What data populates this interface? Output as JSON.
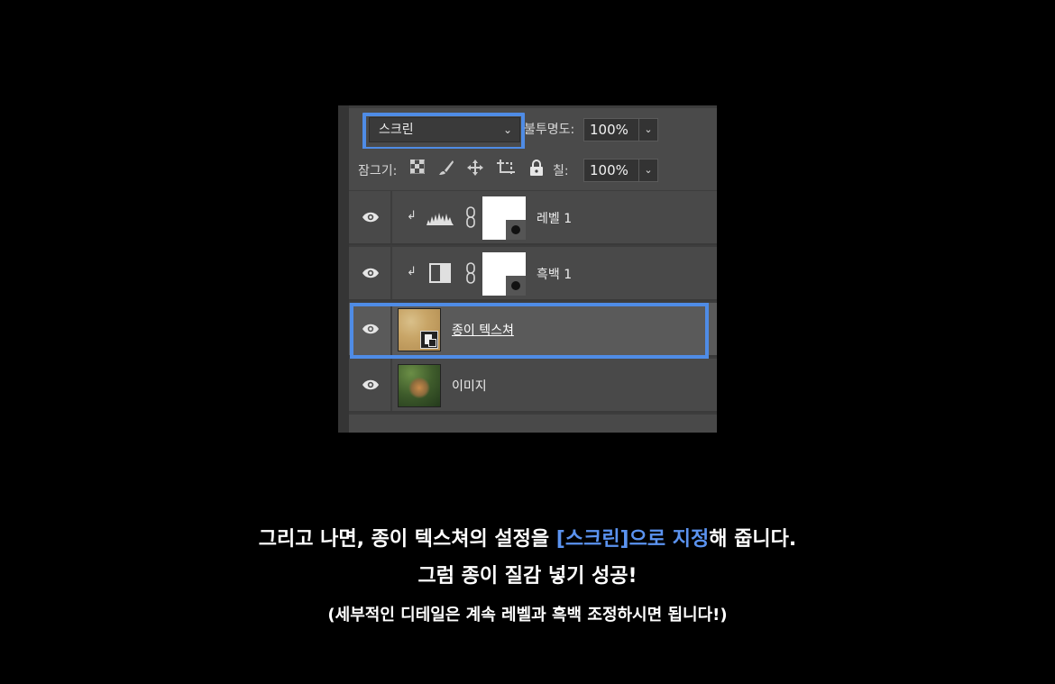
{
  "panel": {
    "blend_mode": "스크린",
    "opacity_label": "불투명도:",
    "opacity_value": "100%",
    "lock_label": "잠그기:",
    "fill_label": "칠:",
    "fill_value": "100%",
    "layers": [
      {
        "name": "레벨 1",
        "type": "levels-adjustment",
        "clipped": true
      },
      {
        "name": "흑백 1",
        "type": "black-white-adjustment",
        "clipped": true
      },
      {
        "name": "종이 텍스쳐",
        "type": "smart-object",
        "selected": true
      },
      {
        "name": "이미지",
        "type": "image"
      }
    ]
  },
  "caption": {
    "line1_a": "그리고 나면, 종이 텍스쳐의 설정을 ",
    "line1_b": "[스크린]으로 지정",
    "line1_c": "해 줍니다.",
    "line2": "그럼 종이 질감 넣기 성공!",
    "line3": "(세부적인 디테일은 계속 레벨과 흑백 조정하시면 됩니다!)"
  },
  "colors": {
    "highlight": "#4f8ce6",
    "caption_accent": "#5b93f0",
    "background": "#000000",
    "panel": "#494949"
  }
}
